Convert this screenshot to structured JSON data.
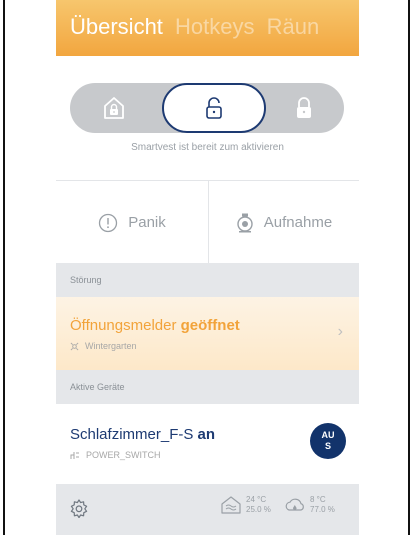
{
  "header": {
    "tabs": [
      {
        "label": "Übersicht",
        "active": true
      },
      {
        "label": "Hotkeys",
        "active": false
      },
      {
        "label": "Räun",
        "active": false
      }
    ]
  },
  "arm": {
    "modes": [
      {
        "name": "home-lock-icon",
        "selected": false
      },
      {
        "name": "unlock-icon",
        "selected": true
      },
      {
        "name": "lock-icon",
        "selected": false
      }
    ],
    "status": "Smartvest ist bereit zum aktivieren"
  },
  "actions": {
    "panic_label": "Panik",
    "record_label": "Aufnahme"
  },
  "sections": {
    "fault": "Störung",
    "active_devices": "Aktive Geräte"
  },
  "alert": {
    "name": "Öffnungsmelder",
    "state": "geöffnet",
    "location": "Wintergarten",
    "icon": "sensor-icon"
  },
  "device": {
    "name": "Schlafzimmer_F-S",
    "state": "an",
    "type": "POWER_SWITCH",
    "badge_line1": "AU",
    "badge_line2": "S"
  },
  "bottom": {
    "indoor_temp": "24 °C",
    "indoor_humidity": "25.0 %",
    "outdoor_temp": "8 °C",
    "outdoor_humidity": "77.0 %"
  },
  "colors": {
    "accent": "#f2a63f",
    "navy": "#12336b",
    "muted": "#9aa0a6"
  }
}
